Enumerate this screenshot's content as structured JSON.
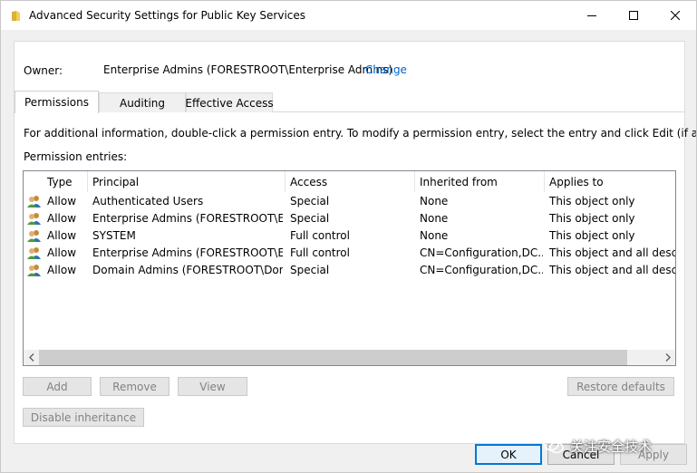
{
  "window": {
    "title": "Advanced Security Settings for Public Key Services"
  },
  "owner": {
    "label": "Owner:",
    "value": "Enterprise Admins (FORESTROOT\\Enterprise Admins)",
    "change_link": "Change"
  },
  "tabs": [
    {
      "label": "Permissions",
      "active": true
    },
    {
      "label": "Auditing",
      "active": false
    },
    {
      "label": "Effective Access",
      "active": false
    }
  ],
  "info_text": "For additional information, double-click a permission entry. To modify a permission entry, select the entry and click Edit (if available).",
  "entries_label": "Permission entries:",
  "columns": [
    "Type",
    "Principal",
    "Access",
    "Inherited from",
    "Applies to"
  ],
  "rows": [
    {
      "type": "Allow",
      "principal": "Authenticated Users",
      "access": "Special",
      "inherited": "None",
      "applies": "This object only"
    },
    {
      "type": "Allow",
      "principal": "Enterprise Admins (FORESTROOT\\Ent...",
      "access": "Special",
      "inherited": "None",
      "applies": "This object only"
    },
    {
      "type": "Allow",
      "principal": "SYSTEM",
      "access": "Full control",
      "inherited": "None",
      "applies": "This object only"
    },
    {
      "type": "Allow",
      "principal": "Enterprise Admins (FORESTROOT\\Ent...",
      "access": "Full control",
      "inherited": "CN=Configuration,DC...",
      "applies": "This object and all descendant objects"
    },
    {
      "type": "Allow",
      "principal": "Domain Admins (FORESTROOT\\Dom...",
      "access": "Special",
      "inherited": "CN=Configuration,DC...",
      "applies": "This object and all descendant objects"
    }
  ],
  "buttons": {
    "add": "Add",
    "remove": "Remove",
    "view": "View",
    "restore_defaults": "Restore defaults",
    "disable_inheritance": "Disable inheritance",
    "ok": "OK",
    "cancel": "Cancel",
    "apply": "Apply"
  },
  "watermark": "关注安全技术",
  "icons": {
    "title": "folder-icon",
    "minimize": "minimize-icon",
    "maximize": "maximize-icon",
    "close": "close-icon",
    "entry": "user-group-icon",
    "scroll_left": "chevron-left-icon",
    "scroll_right": "chevron-right-icon"
  },
  "colors": {
    "link": "#0066cc",
    "accent": "#0078d7"
  }
}
